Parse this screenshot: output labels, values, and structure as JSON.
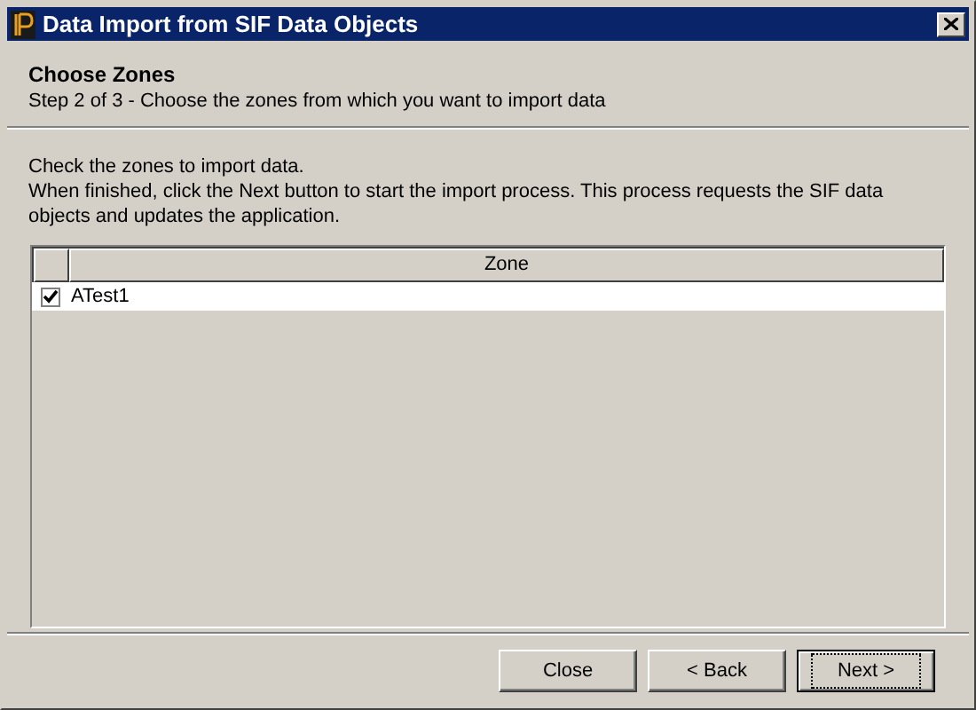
{
  "window": {
    "title": "Data Import from SIF Data Objects"
  },
  "header": {
    "title": "Choose Zones",
    "subtitle": "Step 2 of 3 - Choose the zones from which you want to import data"
  },
  "instructions": [
    "Check the zones to import data.",
    "When finished, click the Next button to start the import process. This process requests the SIF data objects and updates the application."
  ],
  "table": {
    "columns": [
      "Zone"
    ],
    "rows": [
      {
        "name": "ATest1",
        "checked": true
      }
    ]
  },
  "buttons": [
    {
      "label": "Close",
      "default": false
    },
    {
      "label": "< Back",
      "default": false
    },
    {
      "label": "Next >",
      "default": true
    }
  ]
}
